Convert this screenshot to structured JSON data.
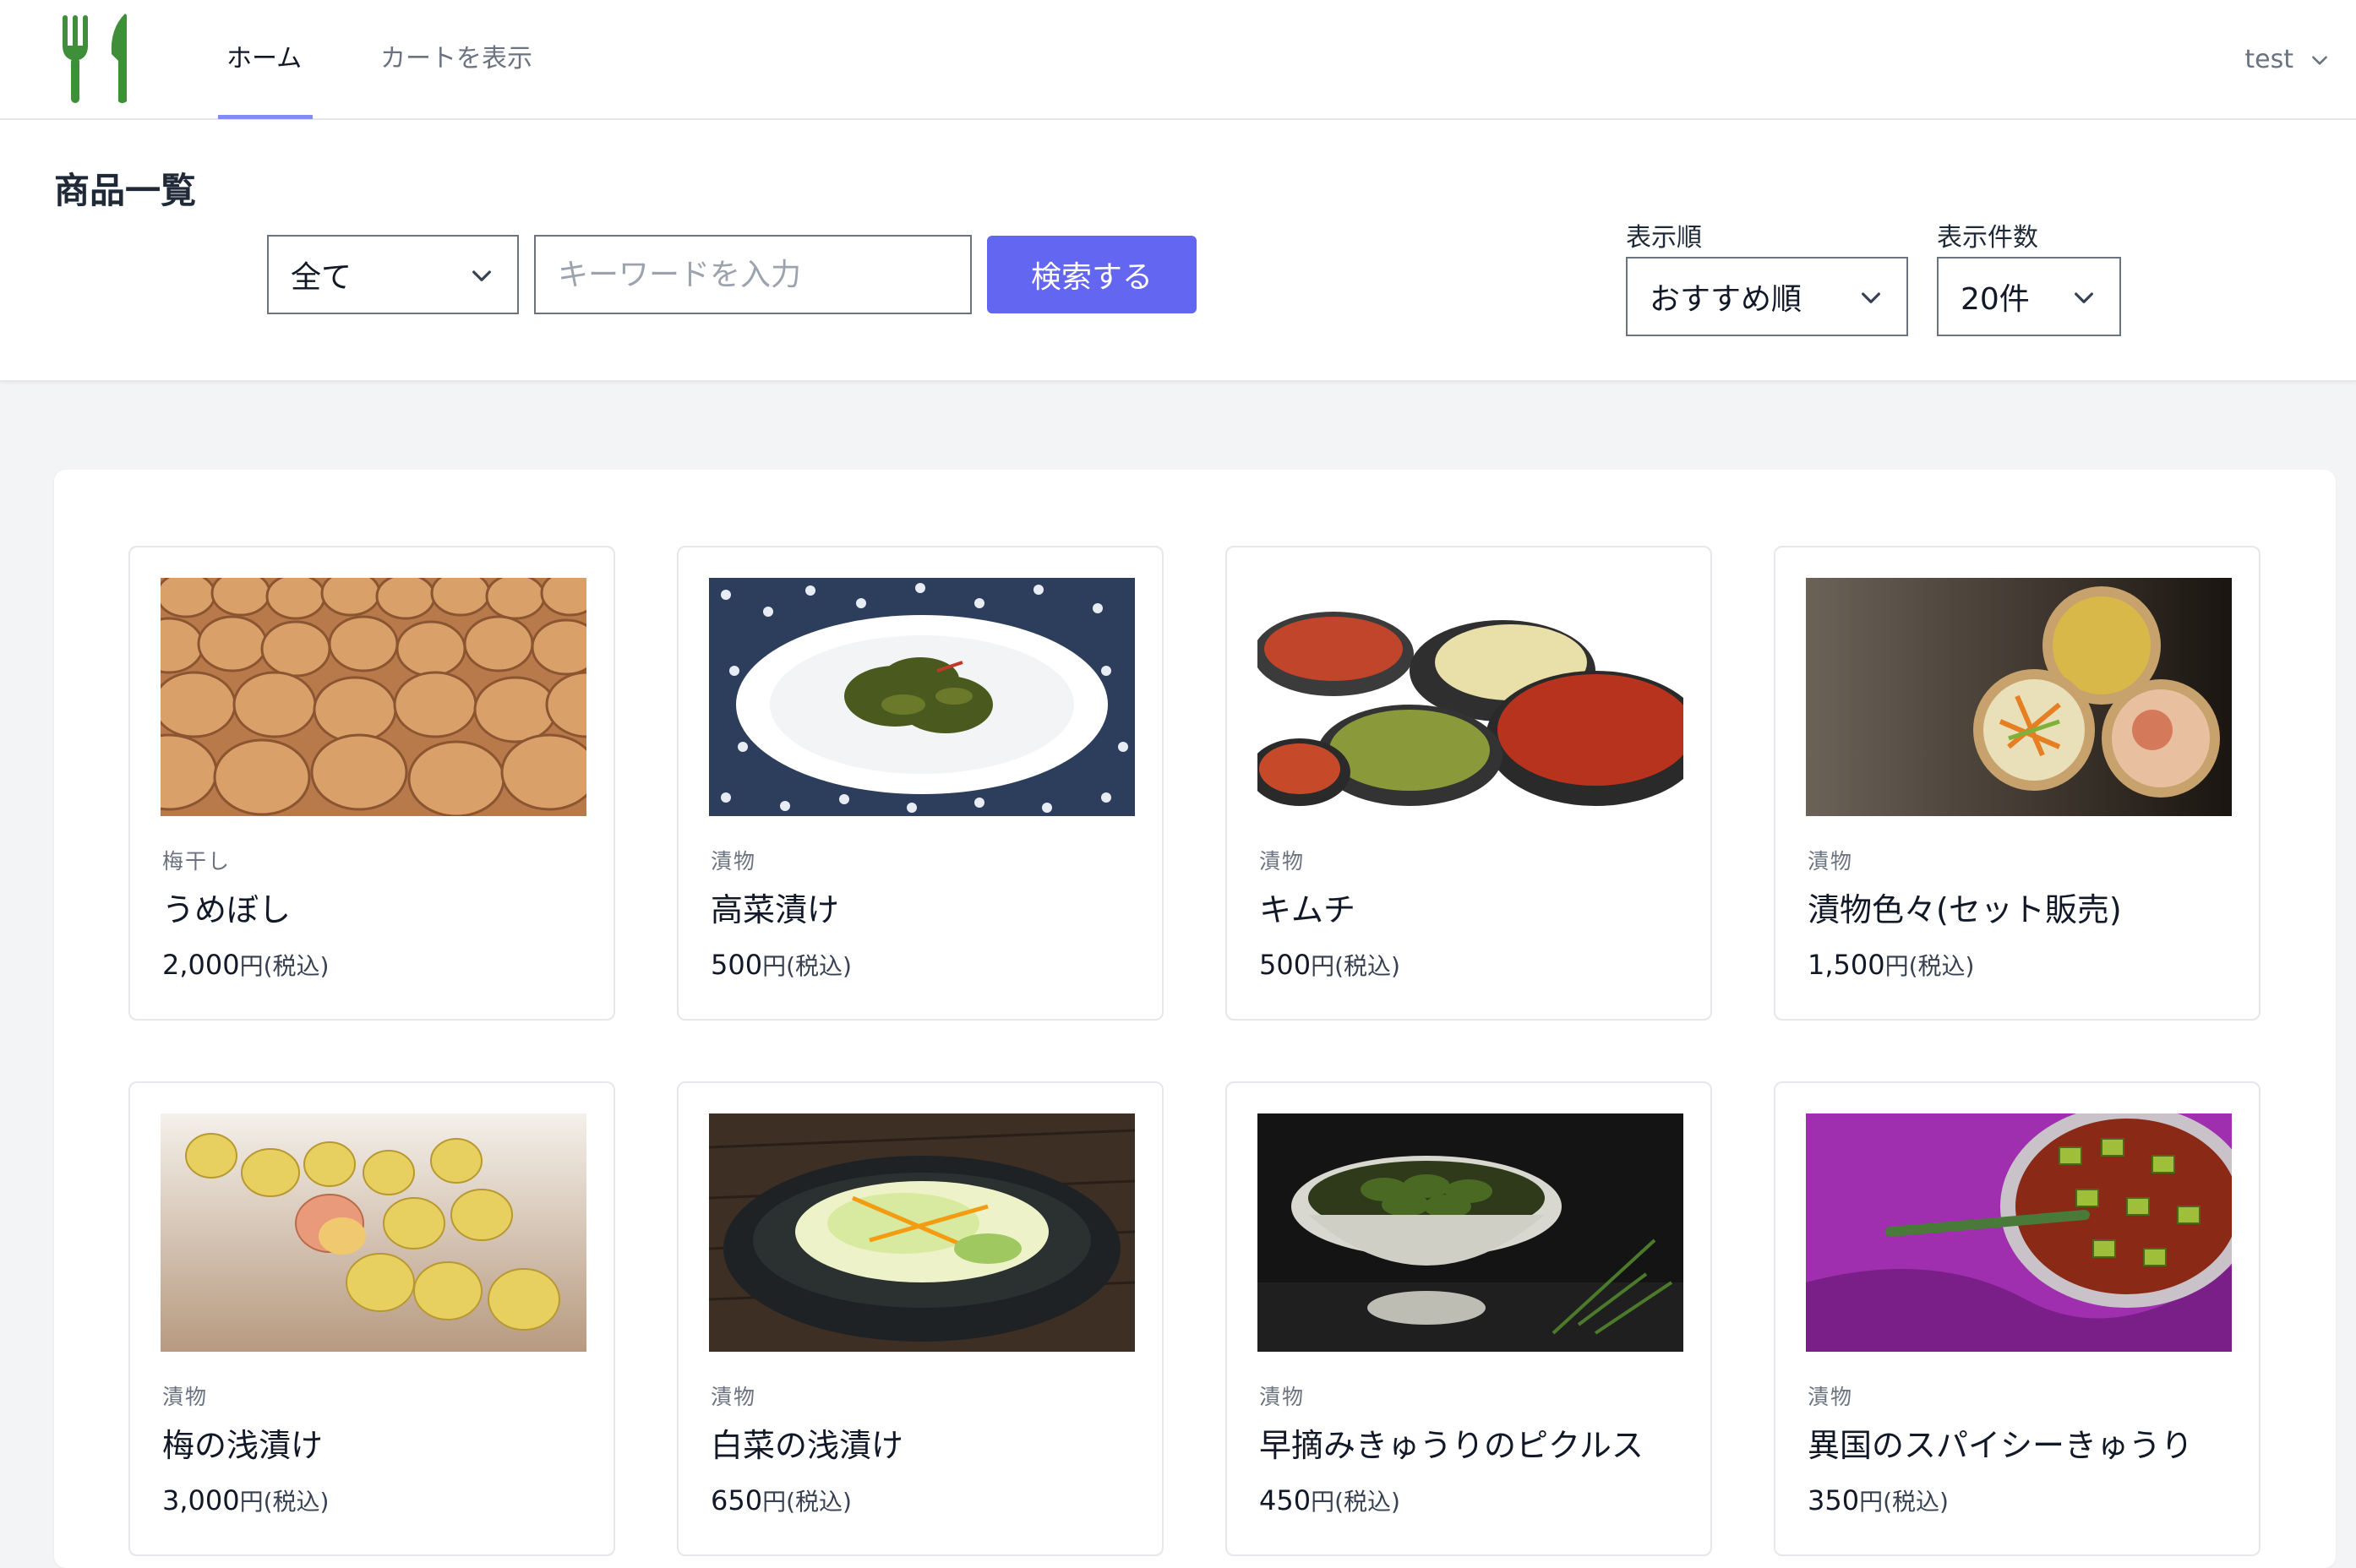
{
  "nav": {
    "logo_icon": "fork-knife-icon",
    "links": [
      {
        "label": "ホーム",
        "active": true
      },
      {
        "label": "カートを表示",
        "active": false
      }
    ],
    "user": "test"
  },
  "search": {
    "title": "商品一覧",
    "category_value": "全て",
    "keyword_placeholder": "キーワードを入力",
    "button_label": "検索する",
    "sort_label": "表示順",
    "sort_value": "おすすめ順",
    "count_label": "表示件数",
    "count_value": "20件"
  },
  "colors": {
    "accent": "#6366f1",
    "nav_underline": "#818cf8",
    "logo": "#3f8f3a"
  },
  "tax_label": "円(税込)",
  "products": [
    {
      "category": "梅干し",
      "name": "うめぼし",
      "price": "2,000",
      "image": "umeboshi-photo"
    },
    {
      "category": "漬物",
      "name": "高菜漬け",
      "price": "500",
      "image": "takana-photo"
    },
    {
      "category": "漬物",
      "name": "キムチ",
      "price": "500",
      "image": "kimchi-photo"
    },
    {
      "category": "漬物",
      "name": "漬物色々(セット販売)",
      "price": "1,500",
      "image": "tsukemono-set-photo"
    },
    {
      "category": "漬物",
      "name": "梅の浅漬け",
      "price": "3,000",
      "image": "ume-asazuke-photo"
    },
    {
      "category": "漬物",
      "name": "白菜の浅漬け",
      "price": "650",
      "image": "hakusai-photo"
    },
    {
      "category": "漬物",
      "name": "早摘みきゅうりのピクルス",
      "price": "450",
      "image": "pickles-photo"
    },
    {
      "category": "漬物",
      "name": "異国のスパイシーきゅうり",
      "price": "350",
      "image": "spicy-cucumber-photo"
    }
  ]
}
